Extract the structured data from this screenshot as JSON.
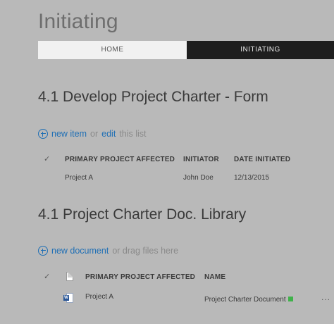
{
  "page": {
    "title": "Initiating"
  },
  "tabs": [
    {
      "label": "HOME"
    },
    {
      "label": "INITIATING"
    }
  ],
  "form_section": {
    "title": "4.1  Develop Project Charter - Form",
    "new_item_link": "new item",
    "or_text": "or",
    "edit_link": "edit",
    "this_list_text": "this list",
    "columns": [
      "PRIMARY PROJECT AFFECTED",
      "INITIATOR",
      "DATE INITIATED"
    ],
    "rows": [
      {
        "project": "Project A",
        "initiator": "John Doe",
        "date": "12/13/2015"
      }
    ]
  },
  "library_section": {
    "title": "4.1 Project Charter Doc. Library",
    "new_document_link": "new document",
    "drag_text": "or drag files here",
    "columns": [
      "PRIMARY PROJECT AFFECTED",
      "NAME"
    ],
    "rows": [
      {
        "project": "Project A",
        "name": "Project Charter Document",
        "more": "..."
      }
    ]
  },
  "icons": {
    "check": "check-icon",
    "add": "plus-circle-icon",
    "file": "document-icon",
    "word": "word-document-icon",
    "new": "new-item-indicator-icon"
  },
  "colors": {
    "background": "#b9b9b9",
    "link": "#1f6fb5",
    "active_tab": "#1e1e1e",
    "inactive_tab": "#f1f1f1",
    "new_indicator": "#3fb24a"
  }
}
